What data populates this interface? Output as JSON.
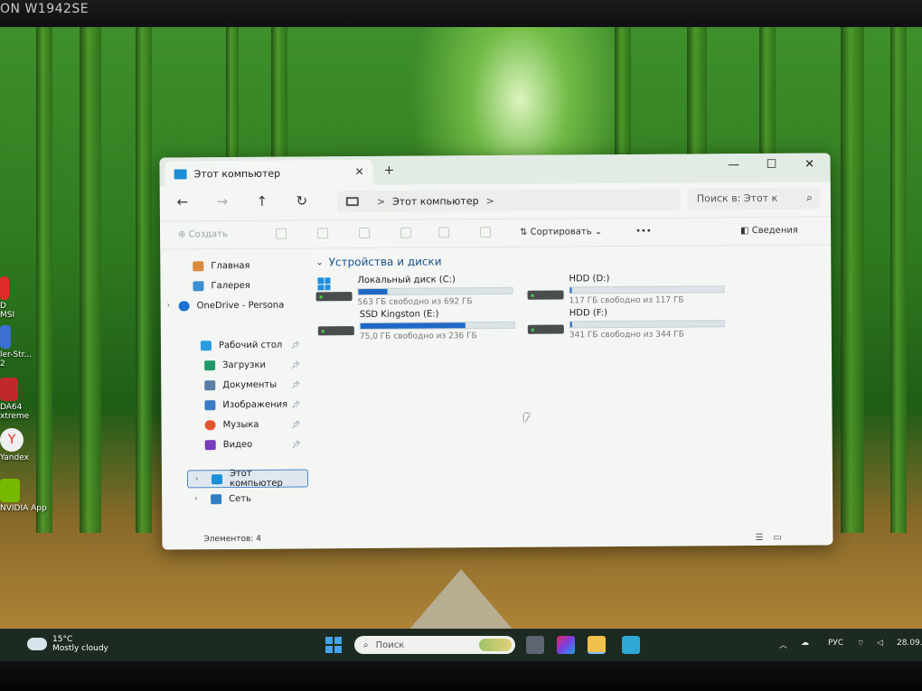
{
  "monitor": {
    "brand": "ON W1942SE"
  },
  "desktop_icons": [
    {
      "label": "D\nMSI",
      "icon": "msi-icon",
      "color": "#e02b2b"
    },
    {
      "label": "ler-Str...\n2",
      "icon": "app-icon",
      "color": "#3b6fd1"
    },
    {
      "label": "DA64\nxtreme",
      "icon": "aida64-icon",
      "color": "#c0282d"
    },
    {
      "label": "Yandex",
      "icon": "yandex-browser-icon",
      "color": "#f0f0f0"
    },
    {
      "label": "NVIDIA App",
      "icon": "nvidia-icon",
      "color": "#76b900"
    }
  ],
  "explorer": {
    "tab_title": "Этот компьютер",
    "tab_close": "✕",
    "new_tab": "+",
    "window_controls": {
      "minimize": "—",
      "maximize": "☐",
      "close": "✕"
    },
    "nav": {
      "back": "←",
      "forward": "→",
      "up": "↑",
      "refresh": "↻"
    },
    "address": {
      "location": "Этот компьютер",
      "separator": ">"
    },
    "search_placeholder": "Поиск в: Этот к",
    "toolbar": {
      "new_label": "Создать",
      "sort_label": "Сортировать",
      "more": "•••",
      "details_label": "Сведения"
    },
    "sidebar": {
      "home": "Главная",
      "gallery": "Галерея",
      "onedrive": "OneDrive - Persona",
      "desktop": "Рабочий стол",
      "downloads": "Загрузки",
      "documents": "Документы",
      "pictures": "Изображения",
      "music": "Музыка",
      "videos": "Видео",
      "this_pc": "Этот компьютер",
      "network": "Сеть"
    },
    "group_title": "Устройства и диски",
    "drives": [
      {
        "name": "Локальный диск (C:)",
        "free": "563 ГБ свободно из 692 ГБ",
        "used_fraction": 0.19,
        "system": true
      },
      {
        "name": "HDD (D:)",
        "free": "117 ГБ свободно из 117 ГБ",
        "used_fraction": 0.0,
        "system": false
      },
      {
        "name": "SSD Kingston (E:)",
        "free": "75,0 ГБ свободно из 236 ГБ",
        "used_fraction": 0.68,
        "system": false
      },
      {
        "name": "HDD (F:)",
        "free": "341 ГБ свободно из 344 ГБ",
        "used_fraction": 0.01,
        "system": false
      }
    ],
    "status": "Элементов: 4"
  },
  "taskbar": {
    "weather_temp": "15°C",
    "weather_desc": "Mostly cloudy",
    "search_placeholder": "Поиск",
    "language": "РУС",
    "date": "28.09."
  },
  "colors": {
    "accent": "#1f68c7",
    "folder_blue": "#1c8fd6"
  }
}
